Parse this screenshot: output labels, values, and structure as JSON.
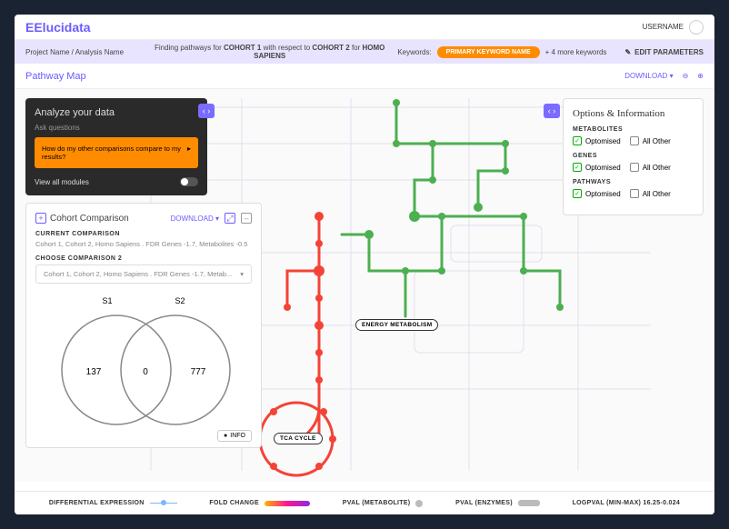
{
  "header": {
    "logo_text": "Elucidata",
    "username": "USERNAME"
  },
  "subbar": {
    "breadcrumb": "Project Name / Analysis Name",
    "finding_prefix": "Finding pathways for ",
    "cohort1": "COHORT 1",
    "finding_mid": " with respect to ",
    "cohort2": "COHORT 2",
    "finding_for": " for ",
    "species": "HOMO SAPIENS",
    "keywords_label": "Keywords:",
    "primary_keyword": "PRIMARY KEYWORD NAME",
    "more_keywords": "+ 4 more keywords",
    "edit_params": "EDIT PARAMETERS"
  },
  "titlebar": {
    "title": "Pathway Map",
    "download": "DOWNLOAD"
  },
  "analyze": {
    "title": "Analyze your data",
    "subtitle": "Ask questions",
    "question": "How do my other comparisons compare to my results?",
    "modules": "View all modules"
  },
  "cohort": {
    "title": "Cohort Comparison",
    "download": "DOWNLOAD",
    "current_label": "CURRENT COMPARISON",
    "current_text": "Cohort 1, Cohort 2, Homo Sapiens . FDR Genes -1.7, Metabolites -0.5",
    "choose_label": "CHOOSE COMPARISON 2",
    "choose_text": "Cohort 1, Cohort 2, Homo Sapiens . FDR Genes -1.7, Metab...",
    "s1": "S1",
    "s2": "S2",
    "left": "137",
    "mid": "0",
    "right": "777",
    "info": "INFO"
  },
  "options": {
    "title": "Options & Information",
    "sections": [
      {
        "label": "METABOLITES",
        "opt1": "Optomised",
        "opt2": "All Other"
      },
      {
        "label": "GENES",
        "opt1": "Optomised",
        "opt2": "All Other"
      },
      {
        "label": "PATHWAYS",
        "opt1": "Optomised",
        "opt2": "All Other"
      }
    ]
  },
  "map_labels": {
    "energy": "ENERGY METABOLISM",
    "tca": "TCA CYCLE"
  },
  "legend": {
    "de": "DIFFERENTIAL EXPRESSION",
    "fc": "FOLD CHANGE",
    "pm": "PVAL (METABOLITE)",
    "pe": "PVAL (ENZYMES)",
    "lp": "LOGPVAL (MIN-MAX) 16.25-0.024"
  }
}
